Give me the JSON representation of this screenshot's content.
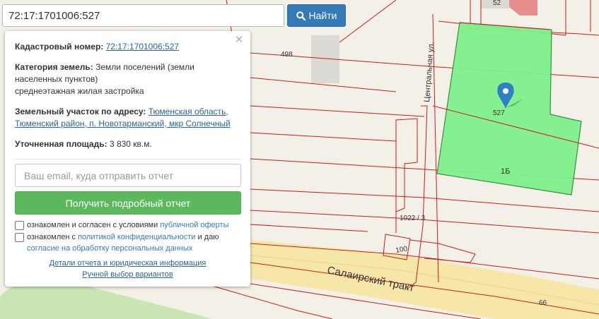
{
  "search": {
    "value": "72:17:1701006:527",
    "button_label": "Найти",
    "button_color": "#337ab7"
  },
  "panel": {
    "cadastral_label": "Кадастровый номер:",
    "cadastral_value": "72:17:1701006:527",
    "category_label": "Категория земель:",
    "category_value": "Земли поселений (земли населенных пунктов)",
    "usage": "среднеэтажная жилая застройка",
    "address_label": "Земельный участок по адресу:",
    "address_value": "Тюменская область, Тюменский район, п. Новотарманский, мкр Солнечный",
    "area_label": "Уточненная площадь:",
    "area_value": "3 830 кв.м.",
    "email_placeholder": "Ваш email, куда отправить отчет",
    "report_button": "Получить подробный отчет",
    "report_button_color": "#5cb85c",
    "check1_text": "ознакомлен и согласен с условиями",
    "check1_link": "публичной оферты",
    "check2_text": "ознакомлен с",
    "check2_link1": "политикой конфиденциальности",
    "check2_mid": "и даю",
    "check2_link2": "согласие на обработку персональных данных",
    "link_details": "Детали отчета и юридическая информация",
    "link_manual": "Ручной выбор вариантов"
  },
  "map": {
    "parcel_color": "#7ff08b",
    "boundary_color": "#cc1c1c",
    "labels": {
      "street_central": "Центральная ул.",
      "street_salair": "Салаирский тракт",
      "parcel_527": "527",
      "lot_1b": "1Б",
      "lot_498": "498",
      "lot_52": "52",
      "lot_1022": "1022 / 3",
      "lot_100": "100",
      "lot_66": "66"
    }
  }
}
